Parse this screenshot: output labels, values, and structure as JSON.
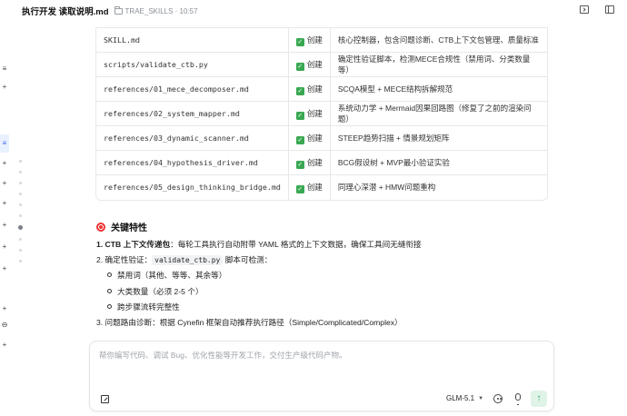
{
  "header": {
    "title": "执行开发 读取说明.md",
    "path": "TRAE_SKILLS · 10:57"
  },
  "table": {
    "rows": [
      {
        "file": "SKILL.md",
        "status": "创建",
        "desc": "核心控制器，包含问题诊断、CTB上下文包管理、质量标准"
      },
      {
        "file": "scripts/validate_ctb.py",
        "status": "创建",
        "desc": "确定性验证脚本，检测MECE合规性（禁用词、分类数量等）"
      },
      {
        "file": "references/01_mece_decomposer.md",
        "status": "创建",
        "desc": "SCQA模型 + MECE结构拆解规范"
      },
      {
        "file": "references/02_system_mapper.md",
        "status": "创建",
        "desc": "系统动力学 + Mermaid因果回路图（修复了之前的渲染问题）"
      },
      {
        "file": "references/03_dynamic_scanner.md",
        "status": "创建",
        "desc": "STEEP趋势扫描 + 情景规划矩阵"
      },
      {
        "file": "references/04_hypothesis_driver.md",
        "status": "创建",
        "desc": "BCG假设树 + MVP最小验证实验"
      },
      {
        "file": "references/05_design_thinking_bridge.md",
        "status": "创建",
        "desc": "同理心深潜 + HMW问题重构"
      }
    ]
  },
  "features": {
    "title": "关键特性",
    "item1_bold": "1. CTB 上下文传递包",
    "item1_rest": "：每轮工具执行自动附带 YAML 格式的上下文数据，确保工具间无缝衔接",
    "item2_prefix": "2. 确定性验证：",
    "item2_code": "validate_ctb.py",
    "item2_suffix": " 脚本可检测：",
    "sub_items": [
      "禁用词（其他、等等、其余等）",
      "大类数量（必须 2-5 个）",
      "跨步骤流转完整性"
    ],
    "item3": "3. 问题路由诊断：根据 Cynefin 框架自动推荐执行路径（Simple/Complicated/Complex）"
  },
  "input": {
    "placeholder": "帮你编写代码、调试 Bug、优化性能等开发工作，交付生产级代码产物。",
    "model": "GLM-5.1"
  },
  "icons": {
    "folder": "folder-icon",
    "terminal": "terminal-icon",
    "split": "split-view-icon",
    "check": "check-icon",
    "target": "target-icon",
    "edit": "edit-icon",
    "chat": "chat-icon",
    "mic": "mic-icon",
    "send": "send-arrow-icon"
  },
  "colors": {
    "check": "#39a852",
    "send_bg": "#dff3e6",
    "accent": "#3b6de0"
  }
}
